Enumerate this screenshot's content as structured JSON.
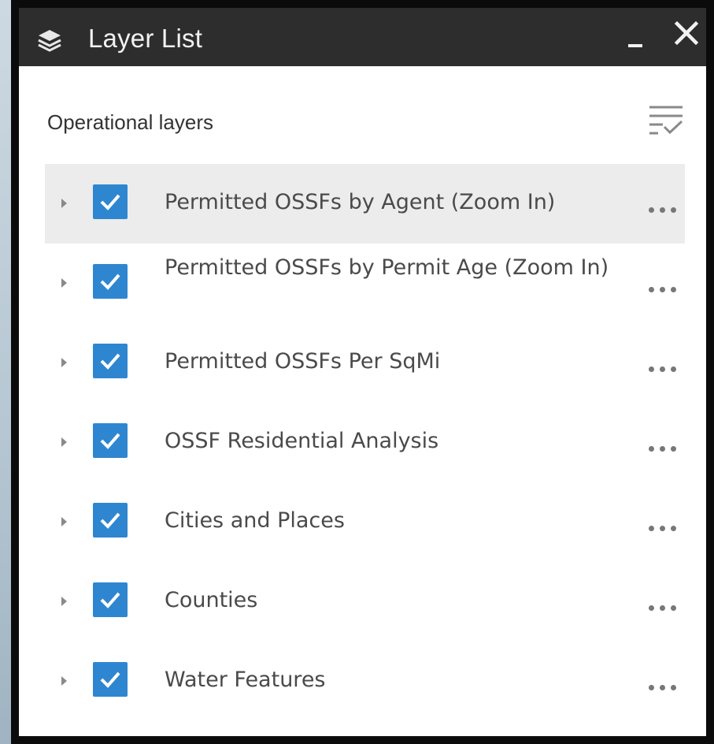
{
  "window": {
    "title": "Layer List",
    "icon": "layers-icon",
    "minimize_icon": "minimize-icon",
    "close_icon": "close-icon"
  },
  "panel": {
    "section_title": "Operational layers",
    "filter_icon": "filter-list-icon"
  },
  "colors": {
    "header_bg": "#2d2d2d",
    "checkbox": "#2f86d0",
    "active_row": "#ececec"
  },
  "layers": [
    {
      "label": "Permitted OSSFs by Agent (Zoom In)",
      "checked": true,
      "active": true
    },
    {
      "label": "Permitted OSSFs by Permit Age (Zoom In)",
      "checked": true,
      "active": false
    },
    {
      "label": "Permitted OSSFs Per SqMi",
      "checked": true,
      "active": false
    },
    {
      "label": "OSSF Residential Analysis",
      "checked": true,
      "active": false
    },
    {
      "label": "Cities and Places",
      "checked": true,
      "active": false
    },
    {
      "label": "Counties",
      "checked": true,
      "active": false
    },
    {
      "label": "Water Features",
      "checked": true,
      "active": false
    }
  ]
}
